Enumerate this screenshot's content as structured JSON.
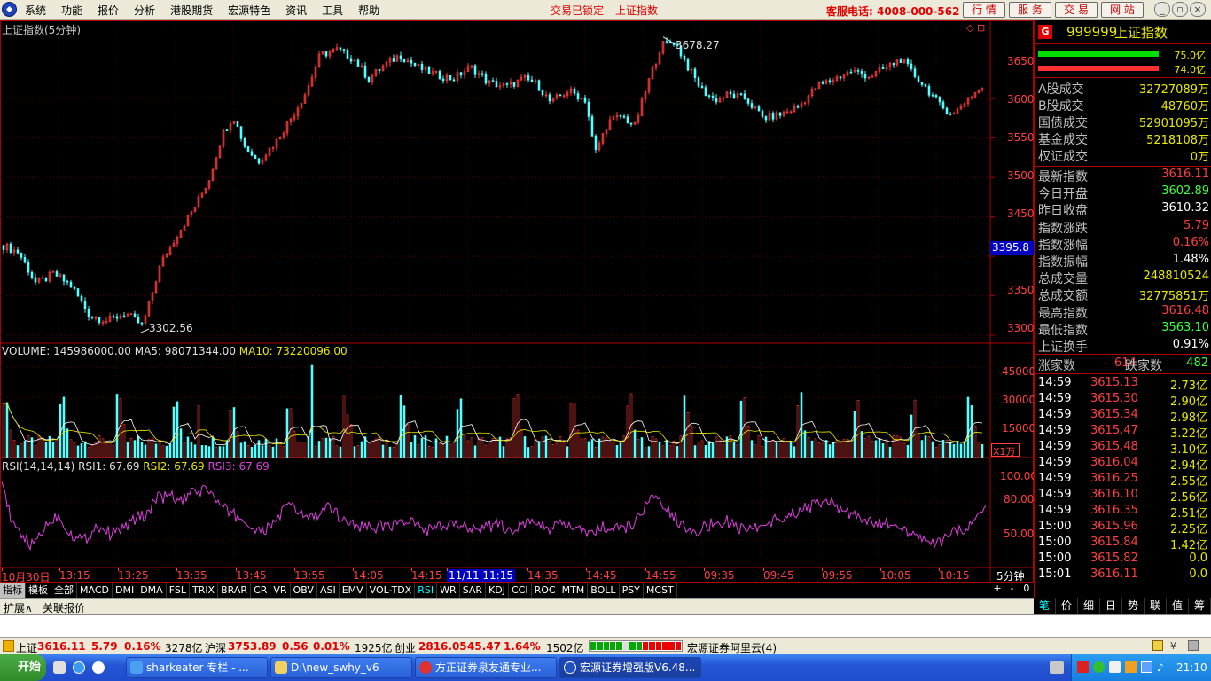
{
  "menu": {
    "items": [
      "系统",
      "功能",
      "报价",
      "分析",
      "港股期货",
      "宏源特色",
      "资讯",
      "工具",
      "帮助"
    ],
    "lock_status": "交易已锁定",
    "index_link": "上证指数",
    "hotline": "客服电话: 4008-000-562",
    "buttons": [
      "行 情",
      "服 务",
      "交 易",
      "网 站"
    ],
    "window_controls": [
      "_",
      "▫",
      "×"
    ]
  },
  "chart": {
    "title": "上证指数(5分钟)",
    "corner_icons": "◇ ⊡",
    "high_label": "3678.27",
    "low_label": "3302.56",
    "current_price_tag": "3395.8",
    "price_ticks": [
      "3650",
      "3600",
      "3550",
      "3500",
      "3450",
      "3400",
      "3350",
      "3300"
    ],
    "volume_header": {
      "volume": "VOLUME: 145986000.00",
      "ma5": "MA5: 98071344.00",
      "ma10": "MA10: 73220096.00"
    },
    "volume_ticks": [
      "45000",
      "30000",
      "15000"
    ],
    "volume_unit": "X1万",
    "rsi_header": {
      "name": "RSI(14,14,14)",
      "rsi1": "RSI1: 67.69",
      "rsi2": "RSI2: 67.69",
      "rsi3": "RSI3: 67.69"
    },
    "rsi_ticks": [
      "100.00",
      "80.00",
      "50.00"
    ],
    "time_labels": [
      "10月30日",
      "13:15",
      "13:25",
      "13:35",
      "13:45",
      "13:55",
      "14:05",
      "14:15",
      "11/11 11:15",
      "14:35",
      "14:45",
      "14:55",
      "09:35",
      "09:45",
      "09:55",
      "10:05",
      "10:15"
    ],
    "period_label": "5分钟",
    "period_controls": [
      "+",
      "-",
      "0"
    ]
  },
  "chart_data": {
    "type": "candlestick",
    "title": "上证指数(5分钟)",
    "ylim": [
      3290,
      3690
    ],
    "high": 3678.27,
    "low": 3302.56,
    "last": 3616.11,
    "close_path": [
      [
        0,
        3415
      ],
      [
        20,
        3405
      ],
      [
        40,
        3365
      ],
      [
        60,
        3378
      ],
      [
        80,
        3362
      ],
      [
        100,
        3325
      ],
      [
        120,
        3318
      ],
      [
        140,
        3328
      ],
      [
        160,
        3312
      ],
      [
        180,
        3390
      ],
      [
        200,
        3430
      ],
      [
        220,
        3465
      ],
      [
        235,
        3498
      ],
      [
        250,
        3555
      ],
      [
        262,
        3578
      ],
      [
        275,
        3540
      ],
      [
        290,
        3520
      ],
      [
        310,
        3545
      ],
      [
        330,
        3580
      ],
      [
        345,
        3610
      ],
      [
        360,
        3655
      ],
      [
        380,
        3662
      ],
      [
        400,
        3648
      ],
      [
        415,
        3625
      ],
      [
        430,
        3640
      ],
      [
        450,
        3655
      ],
      [
        470,
        3640
      ],
      [
        490,
        3630
      ],
      [
        510,
        3625
      ],
      [
        530,
        3640
      ],
      [
        550,
        3620
      ],
      [
        570,
        3615
      ],
      [
        590,
        3625
      ],
      [
        605,
        3618
      ],
      [
        620,
        3595
      ],
      [
        640,
        3610
      ],
      [
        660,
        3598
      ],
      [
        670,
        3530
      ],
      [
        685,
        3570
      ],
      [
        700,
        3578
      ],
      [
        715,
        3565
      ],
      [
        730,
        3620
      ],
      [
        745,
        3668
      ],
      [
        760,
        3672
      ],
      [
        775,
        3640
      ],
      [
        790,
        3612
      ],
      [
        805,
        3598
      ],
      [
        820,
        3605
      ],
      [
        840,
        3600
      ],
      [
        860,
        3575
      ],
      [
        880,
        3580
      ],
      [
        900,
        3590
      ],
      [
        920,
        3615
      ],
      [
        940,
        3625
      ],
      [
        960,
        3635
      ],
      [
        980,
        3628
      ],
      [
        1000,
        3640
      ],
      [
        1015,
        3650
      ],
      [
        1030,
        3630
      ],
      [
        1045,
        3612
      ],
      [
        1060,
        3590
      ],
      [
        1075,
        3580
      ],
      [
        1090,
        3600
      ],
      [
        1110,
        3616
      ]
    ],
    "rsi_path": [
      [
        2,
        100
      ],
      [
        8,
        78
      ],
      [
        15,
        60
      ],
      [
        25,
        55
      ],
      [
        35,
        45
      ],
      [
        50,
        60
      ],
      [
        65,
        70
      ],
      [
        80,
        55
      ],
      [
        95,
        50
      ],
      [
        110,
        62
      ],
      [
        125,
        55
      ],
      [
        140,
        60
      ],
      [
        155,
        68
      ],
      [
        165,
        70
      ],
      [
        175,
        82
      ],
      [
        190,
        85
      ],
      [
        205,
        80
      ],
      [
        220,
        88
      ],
      [
        235,
        90
      ],
      [
        250,
        75
      ],
      [
        265,
        70
      ],
      [
        280,
        62
      ],
      [
        295,
        55
      ],
      [
        310,
        65
      ],
      [
        325,
        78
      ],
      [
        340,
        70
      ],
      [
        355,
        68
      ],
      [
        370,
        75
      ],
      [
        385,
        68
      ],
      [
        400,
        62
      ],
      [
        420,
        60
      ],
      [
        440,
        62
      ],
      [
        460,
        65
      ],
      [
        480,
        58
      ],
      [
        500,
        60
      ],
      [
        520,
        62
      ],
      [
        540,
        60
      ],
      [
        560,
        62
      ],
      [
        580,
        58
      ],
      [
        600,
        65
      ],
      [
        620,
        60
      ],
      [
        640,
        62
      ],
      [
        660,
        55
      ],
      [
        680,
        60
      ],
      [
        700,
        58
      ],
      [
        715,
        62
      ],
      [
        730,
        80
      ],
      [
        740,
        82
      ],
      [
        755,
        72
      ],
      [
        770,
        62
      ],
      [
        785,
        58
      ],
      [
        800,
        62
      ],
      [
        820,
        65
      ],
      [
        840,
        58
      ],
      [
        860,
        62
      ],
      [
        880,
        68
      ],
      [
        900,
        72
      ],
      [
        920,
        78
      ],
      [
        935,
        82
      ],
      [
        950,
        72
      ],
      [
        970,
        68
      ],
      [
        990,
        62
      ],
      [
        1010,
        65
      ],
      [
        1025,
        55
      ],
      [
        1040,
        50
      ],
      [
        1060,
        48
      ],
      [
        1075,
        55
      ],
      [
        1090,
        60
      ],
      [
        1110,
        72
      ]
    ]
  },
  "quote": {
    "code": "999999",
    "name": "上证指数",
    "badge": "G",
    "bar_top": "75.0亿",
    "bar_bottom": "74.0亿",
    "turnover": [
      {
        "k": "A股成交",
        "v": "32727089万"
      },
      {
        "k": "B股成交",
        "v": "48760万"
      },
      {
        "k": "国债成交",
        "v": "52901095万"
      },
      {
        "k": "基金成交",
        "v": "5218108万"
      },
      {
        "k": "权证成交",
        "v": "0万"
      }
    ],
    "stats": [
      {
        "k": "最新指数",
        "v": "3616.11",
        "c": "#ff4040"
      },
      {
        "k": "今日开盘",
        "v": "3602.89",
        "c": "#40ff40"
      },
      {
        "k": "昨日收盘",
        "v": "3610.32",
        "c": "#ffffff"
      },
      {
        "k": "指数涨跌",
        "v": "5.79",
        "c": "#ff4040"
      },
      {
        "k": "指数涨幅",
        "v": "0.16%",
        "c": "#ff4040"
      },
      {
        "k": "指数振幅",
        "v": "1.48%",
        "c": "#ffffff"
      },
      {
        "k": "总成交量",
        "v": "248810524",
        "c": "#e8e800"
      },
      {
        "k": "总成交额",
        "v": "32775851万",
        "c": "#e8e800"
      },
      {
        "k": "最高指数",
        "v": "3616.48",
        "c": "#ff4040"
      },
      {
        "k": "最低指数",
        "v": "3563.10",
        "c": "#40ff40"
      },
      {
        "k": "上证换手",
        "v": "0.91%",
        "c": "#ffffff"
      }
    ],
    "up_label": "涨家数",
    "up_count": "614",
    "down_label": "跌家数",
    "down_count": "482",
    "ticks": [
      {
        "t": "14:59",
        "p": "3615.13",
        "a": "2.73亿"
      },
      {
        "t": "14:59",
        "p": "3615.30",
        "a": "2.90亿"
      },
      {
        "t": "14:59",
        "p": "3615.34",
        "a": "2.98亿"
      },
      {
        "t": "14:59",
        "p": "3615.47",
        "a": "3.22亿"
      },
      {
        "t": "14:59",
        "p": "3615.48",
        "a": "3.10亿"
      },
      {
        "t": "14:59",
        "p": "3616.04",
        "a": "2.94亿"
      },
      {
        "t": "14:59",
        "p": "3616.25",
        "a": "2.55亿"
      },
      {
        "t": "14:59",
        "p": "3616.10",
        "a": "2.56亿"
      },
      {
        "t": "14:59",
        "p": "3616.35",
        "a": "2.51亿"
      },
      {
        "t": "15:00",
        "p": "3615.96",
        "a": "2.25亿"
      },
      {
        "t": "15:00",
        "p": "3615.84",
        "a": "1.42亿"
      },
      {
        "t": "15:00",
        "p": "3615.82",
        "a": "0.0"
      },
      {
        "t": "15:01",
        "p": "3616.11",
        "a": "0.0"
      }
    ],
    "tabs": [
      "笔",
      "价",
      "细",
      "日",
      "势",
      "联",
      "值",
      "筹"
    ]
  },
  "indicator_tabs": [
    "指标",
    "模板",
    "全部",
    "MACD",
    "DMI",
    "DMA",
    "FSL",
    "TRIX",
    "BRAR",
    "CR",
    "VR",
    "OBV",
    "ASI",
    "EMV",
    "VOL-TDX",
    "RSI",
    "WR",
    "SAR",
    "KDJ",
    "CCI",
    "ROC",
    "MTM",
    "BOLL",
    "PSY",
    "MCST"
  ],
  "ext_tabs": [
    "扩展∧",
    "关联报价"
  ],
  "ticker": {
    "sh_name": "上证",
    "sh_val": "3616.11",
    "sh_chg": "5.79",
    "sh_pct": "0.16%",
    "sh_amt": "3278亿",
    "hs_name": "沪深",
    "hs_val": "3753.89",
    "hs_chg": "0.56",
    "hs_pct": "0.01%",
    "hs_amt": "1925亿",
    "cy_name": "创业",
    "cy_val": "2816.05",
    "cy_chg": "45.47",
    "cy_pct": "1.64%",
    "cy_amt": "1502亿",
    "server": "宏源证券阿里云(4)"
  },
  "taskbar": {
    "start": "开始",
    "tasks": [
      "sharkeater 专栏 - ...",
      "D:\\new_swhy_v6",
      "方正证券泉友通专业...",
      "宏源证券增强版V6.48..."
    ],
    "clock": "21:10"
  }
}
